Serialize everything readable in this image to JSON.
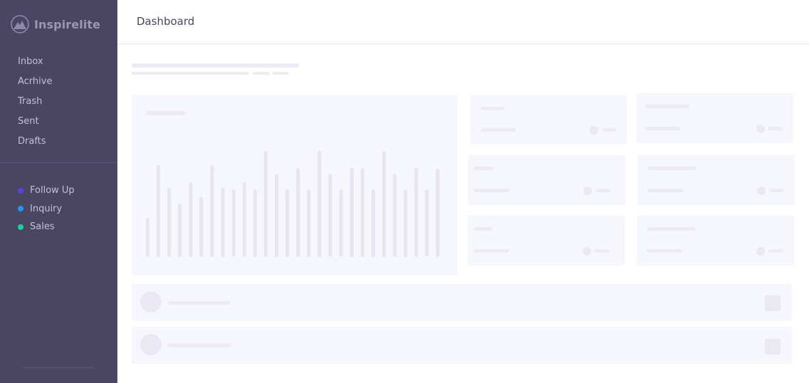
{
  "app": {
    "name": "Inspirelite"
  },
  "header": {
    "title": "Dashboard"
  },
  "sidebar": {
    "nav": [
      {
        "label": "Inbox"
      },
      {
        "label": "Acrhive"
      },
      {
        "label": "Trash"
      },
      {
        "label": "Sent"
      },
      {
        "label": "Drafts"
      }
    ],
    "labels": [
      {
        "label": "Follow Up",
        "color": "#5b3fe0"
      },
      {
        "label": "Inquiry",
        "color": "#1e9af0"
      },
      {
        "label": "Sales",
        "color": "#19d49a"
      }
    ]
  },
  "colors": {
    "sidebar_bg": "#4a4563",
    "placeholder": "#ebeaf5",
    "card_bg": "#f6f6fd"
  },
  "icons": {
    "logo": "mountain-logo-icon"
  }
}
